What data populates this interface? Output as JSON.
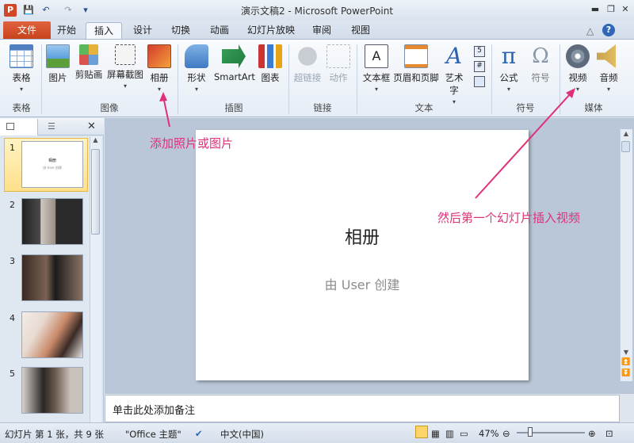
{
  "window": {
    "title": "演示文稿2 - Microsoft PowerPoint",
    "app_icon": "P"
  },
  "qat": {
    "save_icon": "💾",
    "undo_icon": "↶",
    "redo_icon": "↷",
    "customize_icon": "▾"
  },
  "tabs": [
    "文件",
    "开始",
    "插入",
    "设计",
    "切换",
    "动画",
    "幻灯片放映",
    "审阅",
    "视图"
  ],
  "ribbon": {
    "table": "表格",
    "table_group": "表格",
    "picture": "图片",
    "clipart": "剪贴画",
    "screenshot": "屏幕截图",
    "album": "相册",
    "image_group": "图像",
    "shapes": "形状",
    "smartart": "SmartArt",
    "chart": "图表",
    "illus_group": "插图",
    "hyperlink": "超链接",
    "action": "动作",
    "link_group": "链接",
    "textbox": "文本框",
    "headerfooter": "页眉和页脚",
    "wordart": "艺术字",
    "text_group": "文本",
    "equation": "公式",
    "symbol": "符号",
    "symbol_group": "符号",
    "video": "视频",
    "audio": "音频",
    "media_group": "媒体"
  },
  "slides_panel": {
    "numbers": [
      "1",
      "2",
      "3",
      "4",
      "5"
    ],
    "thumb1_title": "相册",
    "thumb1_sub": "由 User 创建"
  },
  "slide": {
    "title": "相册",
    "subtitle": "由 User 创建"
  },
  "notes_placeholder": "单击此处添加备注",
  "status": {
    "slide": "幻灯片 第 1 张，共 9 张",
    "theme": "\"Office 主题\"",
    "lang": "中文(中国)",
    "zoom": "47%"
  },
  "annotations": {
    "album": "添加照片或图片",
    "video": "然后第一个幻灯片插入视频"
  },
  "colors": {
    "annotation": "#e0307a",
    "file_tab": "#c8421c"
  }
}
